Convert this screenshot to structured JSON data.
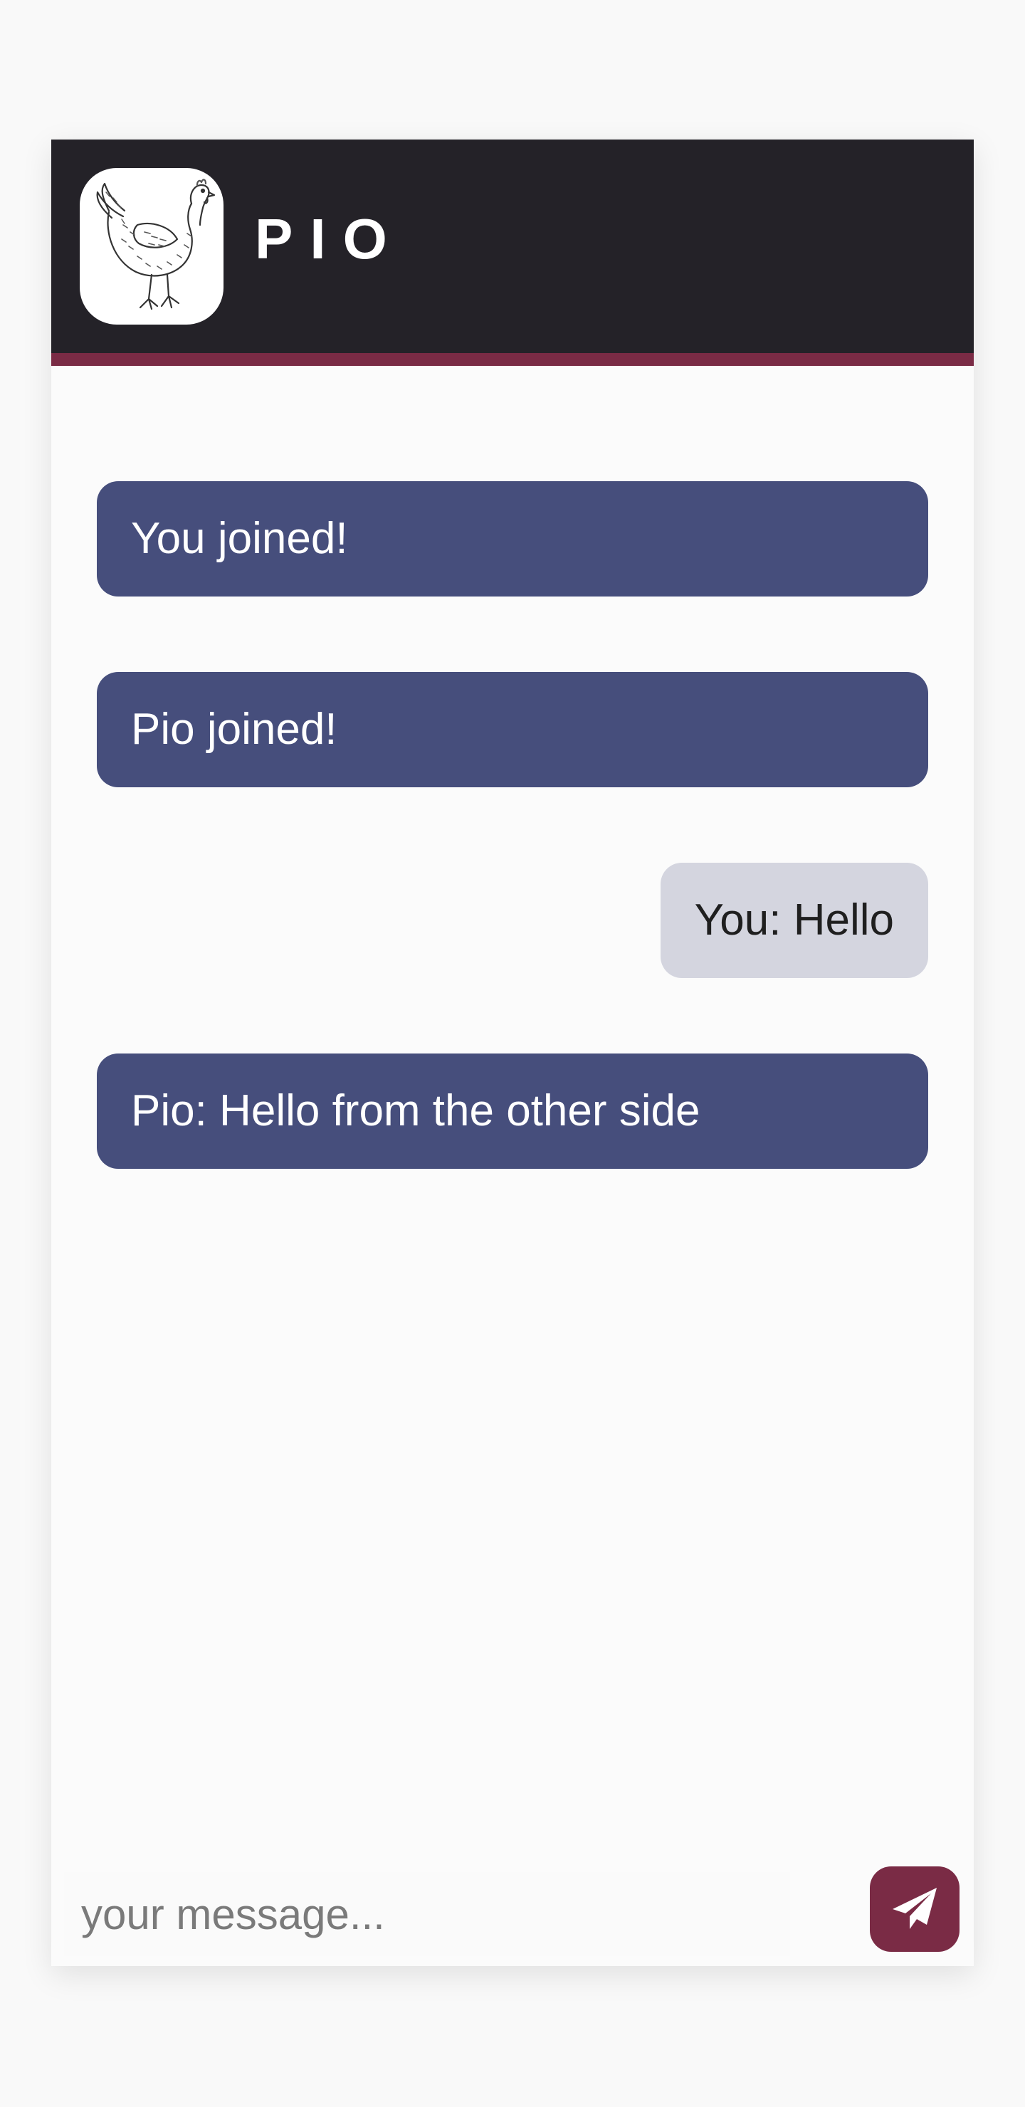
{
  "app": {
    "title": "PIO",
    "logo_icon": "chicken-icon"
  },
  "colors": {
    "header_bg": "#242228",
    "header_accent": "#7a2b45",
    "system_bubble": "#464e7c",
    "outgoing_bubble": "#d4d5df",
    "send_button": "#7a2b45"
  },
  "messages": [
    {
      "type": "system",
      "text": "You joined!"
    },
    {
      "type": "system",
      "text": "Pio joined!"
    },
    {
      "type": "outgoing",
      "text": "You: Hello"
    },
    {
      "type": "incoming",
      "text": "Pio: Hello from the other side"
    }
  ],
  "composer": {
    "placeholder": "your message...",
    "value": "",
    "send_icon": "paper-plane-icon"
  }
}
